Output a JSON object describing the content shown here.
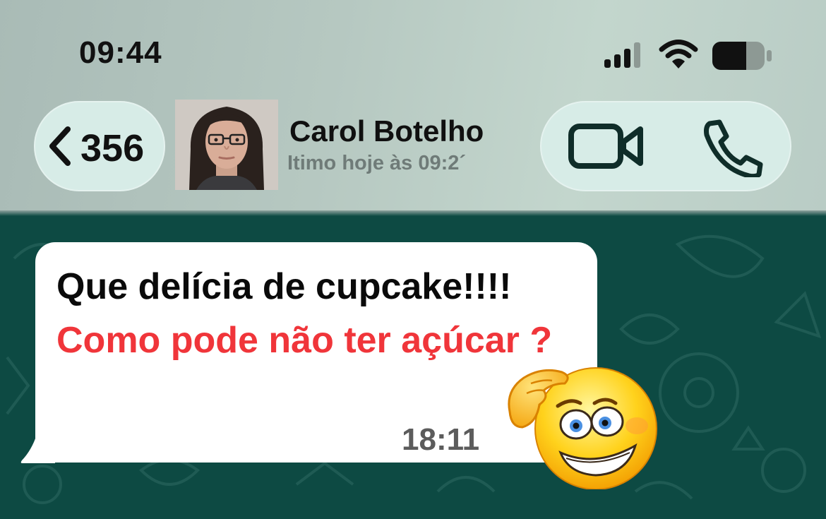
{
  "status_bar": {
    "time": "09:44",
    "icons": [
      "signal-icon",
      "wifi-icon",
      "battery-icon"
    ]
  },
  "header": {
    "back_count": "356",
    "contact_name": "Carol Botelho",
    "contact_status": "Itimo hoje às 09:2´",
    "actions": [
      "video-camera-icon",
      "phone-icon"
    ]
  },
  "message": {
    "text_black": "Que delícia de cupcake!!!! ",
    "text_red": "Como pode não ter açúcar ?",
    "time": "18:11",
    "sticker": "thinking-worried-emoji"
  },
  "colors": {
    "header_background": "#b8cac3",
    "pill_background": "#d7ece7",
    "chat_background": "#0d4a43",
    "bubble_background": "#ffffff",
    "highlight_red": "#f0353a",
    "timestamp_gray": "#5c5c5c"
  }
}
